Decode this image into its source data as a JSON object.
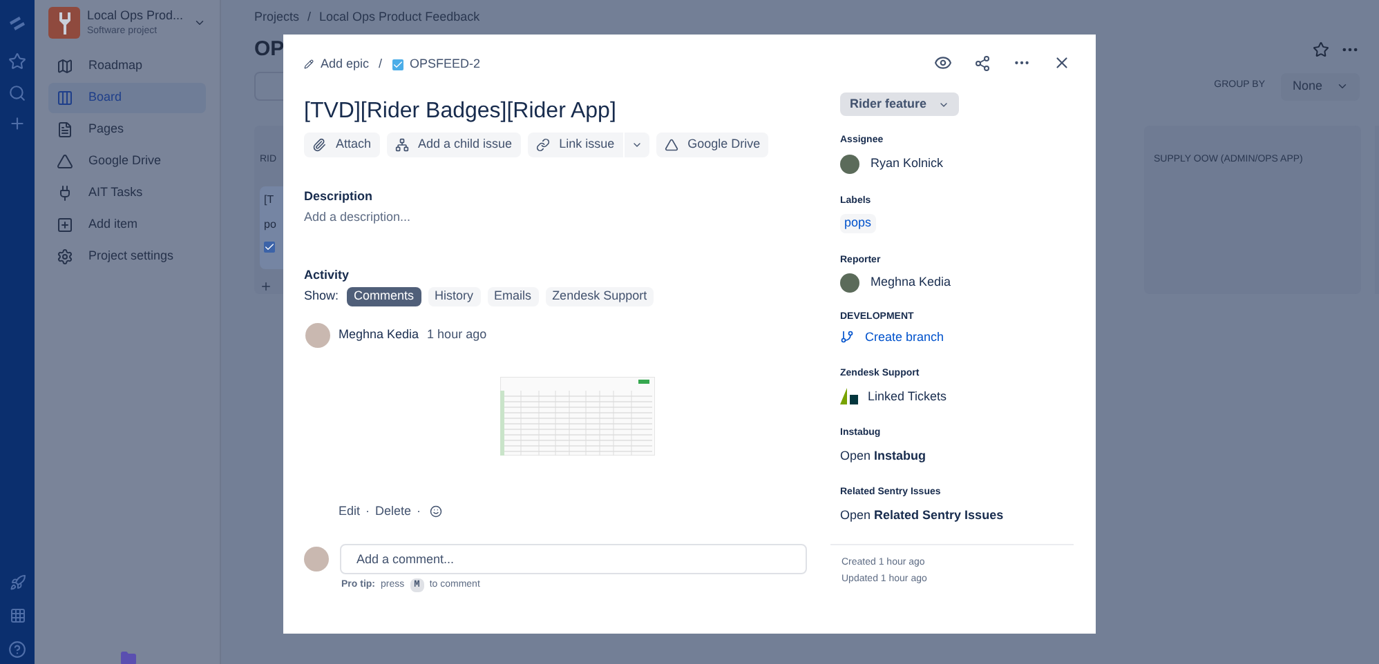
{
  "sidebar": {
    "project": {
      "name": "Local Ops Prod...",
      "type": "Software project"
    },
    "items": [
      {
        "label": "Roadmap",
        "selected": false
      },
      {
        "label": "Board",
        "selected": true
      },
      {
        "label": "Pages",
        "selected": false
      },
      {
        "label": "Google Drive",
        "selected": false
      },
      {
        "label": "AIT Tasks",
        "selected": false
      },
      {
        "label": "Add item",
        "selected": false
      },
      {
        "label": "Project settings",
        "selected": false
      }
    ]
  },
  "breadcrumbs": {
    "items": [
      "Projects",
      "Local Ops Product Feedback"
    ],
    "separator": "/"
  },
  "page_title": "OP",
  "board": {
    "group_by_label": "GROUP BY",
    "group_by_value": "None",
    "columns": [
      {
        "title": "RID"
      },
      {
        "title": "SUPPLY OOW (ADMIN/OPS APP)"
      }
    ],
    "card": {
      "title": "[T",
      "label": "po"
    }
  },
  "issue": {
    "parent": "Add epic",
    "separator": "/",
    "key": "OPSFEED-2",
    "title": "[TVD][Rider Badges][Rider App]",
    "actions": [
      {
        "label": "Attach"
      },
      {
        "label": "Add a child issue"
      },
      {
        "label": "Link issue"
      },
      {
        "label": "Google Drive"
      }
    ],
    "description": {
      "heading": "Description",
      "placeholder": "Add a description..."
    },
    "activity": {
      "heading": "Activity",
      "show_label": "Show:",
      "filters": [
        {
          "label": "Comments",
          "selected": true
        },
        {
          "label": "History",
          "selected": false
        },
        {
          "label": "Emails",
          "selected": false
        },
        {
          "label": "Zendesk Support",
          "selected": false
        }
      ]
    },
    "comment": {
      "author": "Meghna Kedia",
      "time": "1 hour ago",
      "actions": [
        "Edit",
        "Delete"
      ],
      "action_separator": "·"
    },
    "comment_box": {
      "placeholder": "Add a comment...",
      "tip_label": "Pro tip:",
      "tip_before": "press",
      "tip_key": "M",
      "tip_after": "to comment"
    },
    "status": "Rider feature",
    "fields": [
      {
        "kind": "person",
        "label": "Assignee",
        "value": "Ryan Kolnick"
      },
      {
        "kind": "tag",
        "label": "Labels",
        "value": "pops"
      },
      {
        "kind": "person",
        "label": "Reporter",
        "value": "Meghna Kedia"
      },
      {
        "kind": "branch",
        "label": "DEVELOPMENT",
        "value": "Create branch"
      },
      {
        "kind": "zendesk",
        "label": "Zendesk Support",
        "value": "Linked Tickets"
      },
      {
        "kind": "open",
        "label": "Instabug",
        "value": "Open **Instabug**"
      },
      {
        "kind": "open",
        "label": "Related Sentry Issues",
        "value": "Open **Related Sentry Issues**"
      }
    ],
    "footer": [
      "Created 1 hour ago",
      "Updated 1 hour ago"
    ]
  }
}
